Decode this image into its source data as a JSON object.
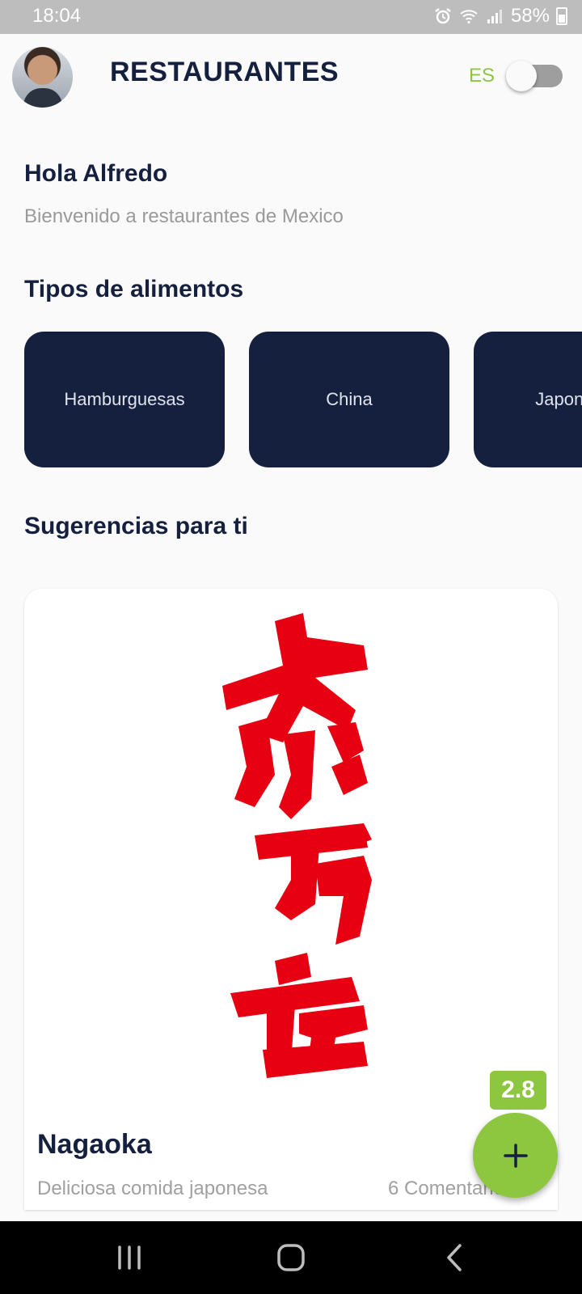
{
  "status_bar": {
    "time": "18:04",
    "battery_text": "58%",
    "icons": [
      "alarm-icon",
      "wifi-icon",
      "signal-icon",
      "battery-icon"
    ]
  },
  "header": {
    "title": "RESTAURANTES",
    "language_label": "ES",
    "language_toggle_on": false
  },
  "greeting": {
    "hello": "Hola Alfredo",
    "welcome": "Bienvenido a restaurantes de Mexico"
  },
  "food_types": {
    "title": "Tipos de alimentos",
    "items": [
      "Hamburguesas",
      "China",
      "Japonesa"
    ]
  },
  "suggestions": {
    "title": "Sugerencias para ti",
    "card": {
      "name": "Nagaoka",
      "description": "Deliciosa comida japonesa",
      "comments": "6 Comentarios",
      "rating": "2.8"
    }
  },
  "fab": {
    "icon": "plus-icon"
  },
  "colors": {
    "navy": "#15203e",
    "accent_green": "#8dc63f",
    "logo_red": "#e60012"
  }
}
